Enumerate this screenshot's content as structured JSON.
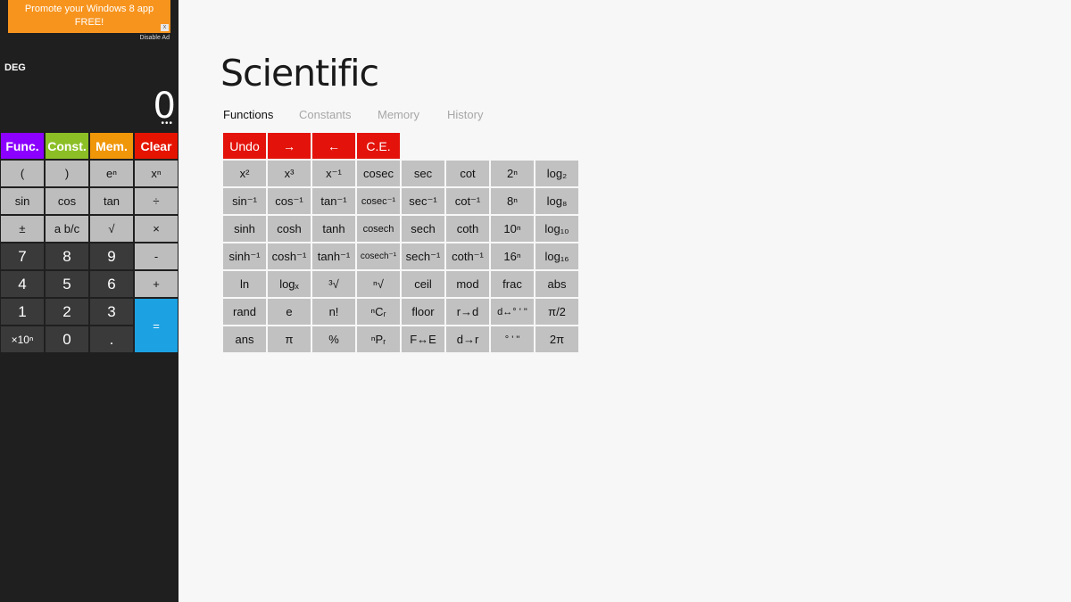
{
  "colors": {
    "sidebar_bg": "#1f1f1f",
    "func": "#8b00ff",
    "const": "#8cbf26",
    "mem": "#f09609",
    "clear": "#e51400",
    "equals": "#1ca1e2",
    "ad": "#f7941d",
    "function_button": "#c1c1c1",
    "action_button": "#e3130b"
  },
  "ad": {
    "line1": "Promote your Windows 8 app",
    "line2": "FREE!",
    "close": "x",
    "disable": "Disable Ad"
  },
  "display": {
    "mode": "DEG",
    "value": "0",
    "dots": "•••"
  },
  "sidebar_tabs": [
    "Func.",
    "Const.",
    "Mem.",
    "Clear"
  ],
  "keypad": {
    "rows": [
      [
        "(",
        ")",
        "eⁿ",
        "xⁿ"
      ],
      [
        "sin",
        "cos",
        "tan",
        "÷"
      ],
      [
        "±",
        "a b/c",
        "√",
        "×"
      ],
      [
        "7",
        "8",
        "9",
        "-"
      ],
      [
        "4",
        "5",
        "6",
        "+"
      ],
      [
        "1",
        "2",
        "3"
      ],
      [
        "×10ⁿ",
        "0",
        "."
      ]
    ],
    "equals": "="
  },
  "main": {
    "title": "Scientific",
    "tabs": [
      "Functions",
      "Constants",
      "Memory",
      "History"
    ],
    "active_tab": "Functions",
    "actions": [
      "Undo",
      "→",
      "←",
      "C.E."
    ],
    "functions": [
      [
        "x²",
        "x³",
        "x⁻¹",
        "cosec",
        "sec",
        "cot",
        "2ⁿ",
        "log₂"
      ],
      [
        "sin⁻¹",
        "cos⁻¹",
        "tan⁻¹",
        "cosec⁻¹",
        "sec⁻¹",
        "cot⁻¹",
        "8ⁿ",
        "log₈"
      ],
      [
        "sinh",
        "cosh",
        "tanh",
        "cosech",
        "sech",
        "coth",
        "10ⁿ",
        "log₁₀"
      ],
      [
        "sinh⁻¹",
        "cosh⁻¹",
        "tanh⁻¹",
        "cosech⁻¹",
        "sech⁻¹",
        "coth⁻¹",
        "16ⁿ",
        "log₁₆"
      ],
      [
        "ln",
        "logₓ",
        "³√",
        "ⁿ√",
        "ceil",
        "mod",
        "frac",
        "abs"
      ],
      [
        "rand",
        "e",
        "n!",
        "ⁿCᵣ",
        "floor",
        "r→d",
        "d↔° ' \"",
        "π/2"
      ],
      [
        "ans",
        "π",
        "%",
        "ⁿPᵣ",
        "F↔E",
        "d→r",
        "° ' \"",
        "2π"
      ]
    ]
  }
}
